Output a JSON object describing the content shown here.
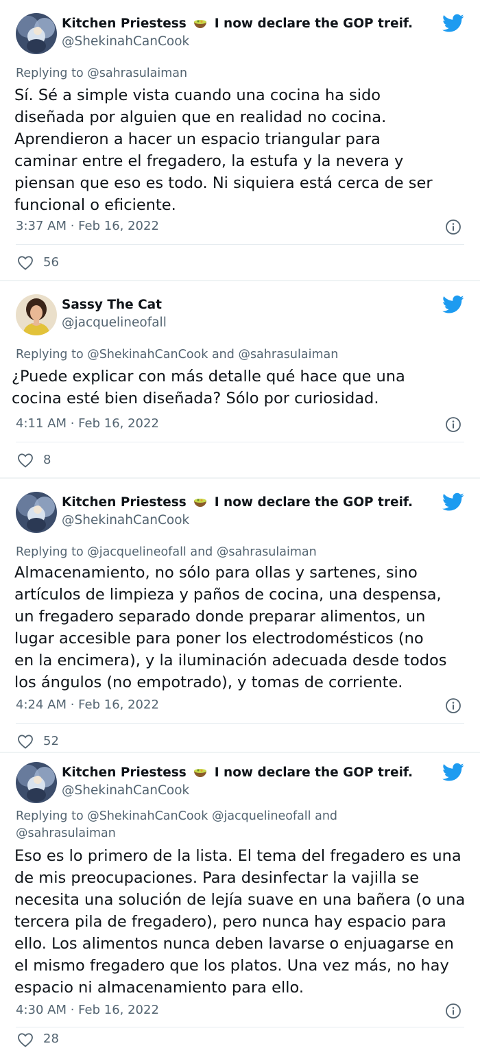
{
  "colors": {
    "accent": "#1d9bf0",
    "secondary_text": "#536471",
    "separator": "#eff3f4"
  },
  "tweets": [
    {
      "display_name": "Kitchen Priestess",
      "display_name_suffix": "I now declare the GOP treif.",
      "handle": "@ShekinahCanCook",
      "replying_to": "Replying to @sahrasulaiman",
      "text": "Sí. Sé a simple vista cuando una cocina ha sido\ndiseñada por alguien que en realidad no cocina.\nAprendieron a hacer un espacio triangular para\ncaminar entre el fregadero, la estufa y la nevera y\npiensan que eso es todo. Ni siquiera está cerca de ser\nfuncional o eficiente.",
      "timestamp": "3:37 AM · Feb 16, 2022",
      "likes": "56",
      "avatar_icon": "angel-avatar"
    },
    {
      "display_name": "Sassy The Cat",
      "display_name_suffix": "",
      "handle": "@jacquelineofall",
      "replying_to": "Replying to @ShekinahCanCook and @sahrasulaiman",
      "text": "¿Puede explicar con más detalle qué hace que una\ncocina esté bien diseñada? Sólo por curiosidad.",
      "timestamp": "4:11 AM · Feb 16, 2022",
      "likes": "8",
      "avatar_icon": "woman-avatar"
    },
    {
      "display_name": "Kitchen Priestess",
      "display_name_suffix": "I now declare the GOP treif.",
      "handle": "@ShekinahCanCook",
      "replying_to": "Replying to @jacquelineofall and @sahrasulaiman",
      "text": "Almacenamiento, no sólo para ollas y sartenes, sino\nartículos de limpieza y paños de cocina, una despensa,\nun fregadero separado donde preparar alimentos, un\nlugar accesible para poner los electrodomésticos (no\nen la encimera), y la iluminación adecuada desde todos\nlos ángulos (no empotrado), y tomas de corriente.",
      "timestamp": "4:24 AM · Feb 16, 2022",
      "likes": "52",
      "avatar_icon": "angel-avatar"
    },
    {
      "display_name": "Kitchen Priestess",
      "display_name_suffix": "I now declare the GOP treif.",
      "handle": "@ShekinahCanCook",
      "replying_to": "Replying to @ShekinahCanCook @jacquelineofall and\n@sahrasulaiman",
      "text": "Eso es lo primero de la lista. El tema del fregadero es una\nde mis preocupaciones. Para desinfectar la vajilla se\nnecesita una solución de lejía suave en una bañera (o una\ntercera pila de fregadero), pero nunca hay espacio para\nello. Los alimentos nunca deben lavarse o enjuagarse en\nel mismo fregadero que los platos. Una vez más, no hay\nespacio ni almacenamiento para ello.",
      "timestamp": "4:30 AM · Feb 16, 2022",
      "likes": "28",
      "avatar_icon": "angel-avatar"
    }
  ]
}
